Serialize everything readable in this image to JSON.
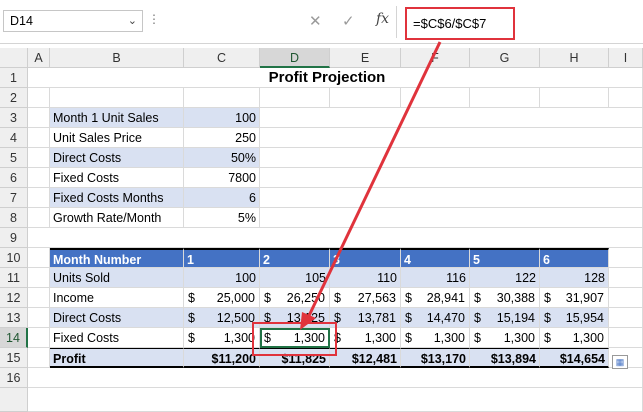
{
  "formula_bar": {
    "name_box": "D14",
    "name_box_arrow": "⌄",
    "cancel": "✕",
    "enter": "✓",
    "fx": "fx",
    "formula": "=$C$6/$C$7"
  },
  "columns": [
    "A",
    "B",
    "C",
    "D",
    "E",
    "F",
    "G",
    "H",
    "I"
  ],
  "rows": [
    "1",
    "2",
    "3",
    "4",
    "5",
    "6",
    "7",
    "8",
    "9",
    "10",
    "11",
    "12",
    "13",
    "14",
    "15",
    "16"
  ],
  "title": "Profit Projection",
  "inputs": [
    {
      "label": "Month 1 Unit Sales",
      "value": "100"
    },
    {
      "label": "Unit Sales Price",
      "value": "250"
    },
    {
      "label": "Direct Costs",
      "value": "50%"
    },
    {
      "label": "Fixed Costs",
      "value": "7800"
    },
    {
      "label": "Fixed Costs Months",
      "value": "6"
    },
    {
      "label": "Growth Rate/Month",
      "value": "5%"
    }
  ],
  "table": {
    "header_label": "Month Number",
    "months": [
      "1",
      "2",
      "3",
      "4",
      "5",
      "6"
    ],
    "units_label": "Units Sold",
    "units": [
      "100",
      "105",
      "110",
      "116",
      "122",
      "128"
    ],
    "currency_symbol": "$",
    "income_label": "Income",
    "income": [
      "25,000",
      "26,250",
      "27,563",
      "28,941",
      "30,388",
      "31,907"
    ],
    "direct_label": "Direct Costs",
    "direct": [
      "12,500",
      "13,125",
      "13,781",
      "14,470",
      "15,194",
      "15,954"
    ],
    "fixed_label": "Fixed Costs",
    "fixed": [
      "1,300",
      "1,300",
      "1,300",
      "1,300",
      "1,300",
      "1,300"
    ],
    "profit_label": "Profit",
    "profit": [
      "$11,200",
      "$11,825",
      "$12,481",
      "$13,170",
      "$13,894",
      "$14,654"
    ]
  },
  "colors": {
    "accent": "#217346",
    "table_header": "#4472c4",
    "band": "#d9e1f2",
    "highlight": "#e0333c"
  }
}
